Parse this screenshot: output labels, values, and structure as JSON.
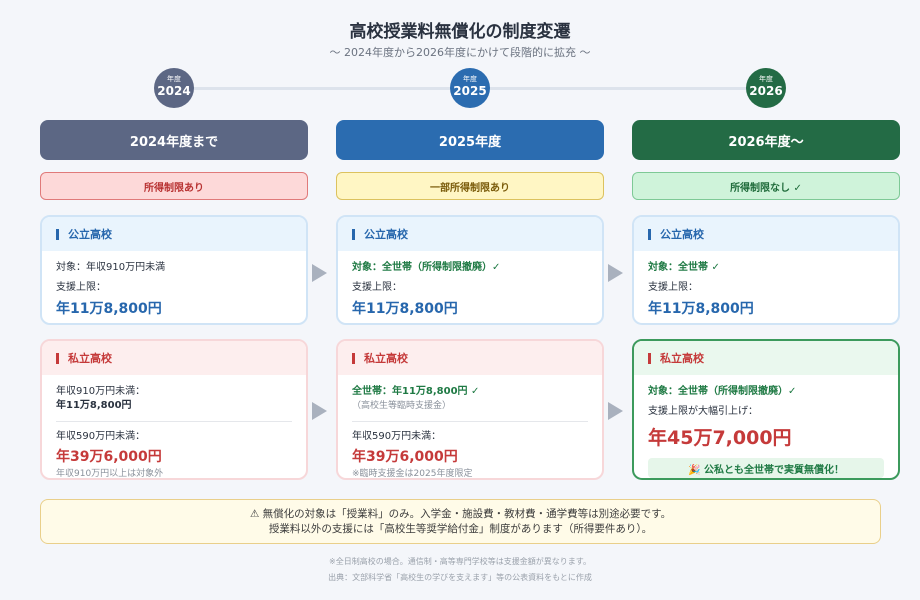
{
  "header": {
    "title": "高校授業料無償化の制度変遷",
    "subtitle": "〜 2024年度から2026年度にかけて段階的に拡充 〜"
  },
  "timeline": [
    {
      "small": "年度",
      "year": "2024",
      "color": "#5c6784"
    },
    {
      "small": "年度",
      "year": "2025",
      "color": "#2b6cb0"
    },
    {
      "small": "年度",
      "year": "2026",
      "color": "#236b45"
    }
  ],
  "columns": [
    {
      "header": "2024年度まで",
      "header_color": "#5c6784",
      "badge": "所得制限あり",
      "badge_colors": {
        "bg": "#fdd9d9",
        "border": "#e07a7a",
        "text": "#b83232"
      },
      "public": {
        "title": "公立高校",
        "target": "対象：年収910万円未満",
        "limit_label": "支援上限：",
        "amount": "年11万8,800円"
      },
      "private": {
        "title": "私立高校",
        "tier1_label": "年収910万円未満：",
        "tier1_amount": "年11万8,800円",
        "tier2_label": "年収590万円未満：",
        "tier2_amount": "年39万6,000円",
        "note": "年収910万円以上は対象外"
      }
    },
    {
      "header": "2025年度",
      "header_color": "#2b6cb0",
      "badge": "一部所得制限あり",
      "badge_colors": {
        "bg": "#fff6c4",
        "border": "#dcc25e",
        "text": "#7a5b0a"
      },
      "public": {
        "title": "公立高校",
        "target": "対象：全世帯（所得制限撤廃）✓",
        "limit_label": "支援上限：",
        "amount": "年11万8,800円"
      },
      "private": {
        "title": "私立高校",
        "tier1_label": "全世帯：年11万8,800円 ✓",
        "tier1_sub": "（高校生等臨時支援金）",
        "tier2_label": "年収590万円未満：",
        "tier2_amount": "年39万6,000円",
        "note": "※臨時支援金は2025年度限定"
      }
    },
    {
      "header": "2026年度〜",
      "header_color": "#236b45",
      "badge": "所得制限なし ✓",
      "badge_colors": {
        "bg": "#cff3da",
        "border": "#7ec996",
        "text": "#1f6b3a"
      },
      "public": {
        "title": "公立高校",
        "target": "対象：全世帯 ✓",
        "limit_label": "支援上限：",
        "amount": "年11万8,800円"
      },
      "private": {
        "title": "私立高校",
        "target": "対象：全世帯（所得制限撤廃）✓",
        "limit_label": "支援上限が大幅引上げ：",
        "amount": "年45万7,000円",
        "highlight": "🎉 公私とも全世帯で実質無償化！"
      }
    }
  ],
  "notice": {
    "line1": "⚠ 無償化の対象は「授業料」のみ。入学金・施設費・教材費・通学費等は別途必要です。",
    "line2": "授業料以外の支援には「高校生等奨学給付金」制度があります（所得要件あり）。"
  },
  "footnotes": {
    "line1": "※全日制高校の場合。通信制・高等専門学校等は支援金額が異なります。",
    "line2": "出典：文部科学省「高校生の学びを支えます」等の公表資料をもとに作成"
  }
}
